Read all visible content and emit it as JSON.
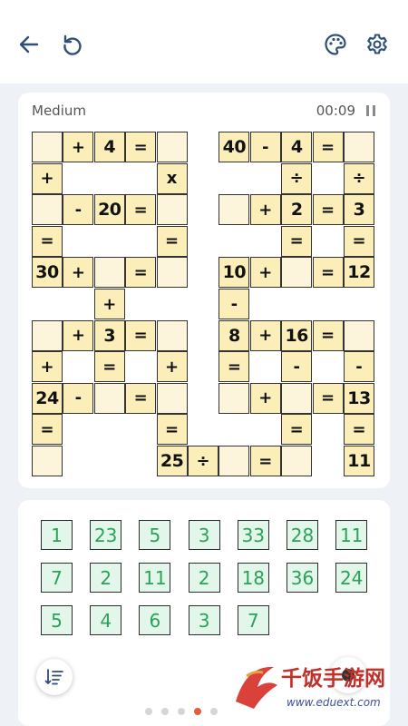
{
  "header": {
    "back_icon": "arrow-left-icon",
    "restart_icon": "restart-icon",
    "theme_icon": "palette-icon",
    "settings_icon": "gear-icon"
  },
  "puzzle": {
    "difficulty": "Medium",
    "timer": "00:09",
    "cells": [
      {
        "c": 0,
        "r": 0,
        "t": "blank",
        "v": ""
      },
      {
        "c": 1,
        "r": 0,
        "t": "op",
        "v": "+"
      },
      {
        "c": 2,
        "r": 0,
        "t": "num",
        "v": "4"
      },
      {
        "c": 3,
        "r": 0,
        "t": "op",
        "v": "="
      },
      {
        "c": 4,
        "r": 0,
        "t": "blank",
        "v": ""
      },
      {
        "c": 6,
        "r": 0,
        "t": "num",
        "v": "40"
      },
      {
        "c": 7,
        "r": 0,
        "t": "op",
        "v": "-"
      },
      {
        "c": 8,
        "r": 0,
        "t": "num",
        "v": "4"
      },
      {
        "c": 9,
        "r": 0,
        "t": "op",
        "v": "="
      },
      {
        "c": 10,
        "r": 0,
        "t": "blank",
        "v": ""
      },
      {
        "c": 0,
        "r": 1,
        "t": "op",
        "v": "+"
      },
      {
        "c": 4,
        "r": 1,
        "t": "op",
        "v": "x"
      },
      {
        "c": 8,
        "r": 1,
        "t": "op",
        "v": "÷"
      },
      {
        "c": 10,
        "r": 1,
        "t": "op",
        "v": "÷"
      },
      {
        "c": 0,
        "r": 2,
        "t": "blank",
        "v": ""
      },
      {
        "c": 1,
        "r": 2,
        "t": "op",
        "v": "-"
      },
      {
        "c": 2,
        "r": 2,
        "t": "num",
        "v": "20"
      },
      {
        "c": 3,
        "r": 2,
        "t": "op",
        "v": "="
      },
      {
        "c": 4,
        "r": 2,
        "t": "blank",
        "v": ""
      },
      {
        "c": 6,
        "r": 2,
        "t": "blank",
        "v": ""
      },
      {
        "c": 7,
        "r": 2,
        "t": "op",
        "v": "+"
      },
      {
        "c": 8,
        "r": 2,
        "t": "num",
        "v": "2"
      },
      {
        "c": 9,
        "r": 2,
        "t": "op",
        "v": "="
      },
      {
        "c": 10,
        "r": 2,
        "t": "num",
        "v": "3"
      },
      {
        "c": 0,
        "r": 3,
        "t": "op",
        "v": "="
      },
      {
        "c": 4,
        "r": 3,
        "t": "op",
        "v": "="
      },
      {
        "c": 8,
        "r": 3,
        "t": "op",
        "v": "="
      },
      {
        "c": 10,
        "r": 3,
        "t": "op",
        "v": "="
      },
      {
        "c": 0,
        "r": 4,
        "t": "num",
        "v": "30"
      },
      {
        "c": 1,
        "r": 4,
        "t": "op",
        "v": "+"
      },
      {
        "c": 2,
        "r": 4,
        "t": "blank",
        "v": ""
      },
      {
        "c": 3,
        "r": 4,
        "t": "op",
        "v": "="
      },
      {
        "c": 4,
        "r": 4,
        "t": "blank",
        "v": ""
      },
      {
        "c": 6,
        "r": 4,
        "t": "num",
        "v": "10"
      },
      {
        "c": 7,
        "r": 4,
        "t": "op",
        "v": "+"
      },
      {
        "c": 8,
        "r": 4,
        "t": "blank",
        "v": ""
      },
      {
        "c": 9,
        "r": 4,
        "t": "op",
        "v": "="
      },
      {
        "c": 10,
        "r": 4,
        "t": "num",
        "v": "12"
      },
      {
        "c": 2,
        "r": 5,
        "t": "op",
        "v": "+"
      },
      {
        "c": 6,
        "r": 5,
        "t": "op",
        "v": "-"
      },
      {
        "c": 0,
        "r": 6,
        "t": "blank",
        "v": ""
      },
      {
        "c": 1,
        "r": 6,
        "t": "op",
        "v": "+"
      },
      {
        "c": 2,
        "r": 6,
        "t": "num",
        "v": "3"
      },
      {
        "c": 3,
        "r": 6,
        "t": "op",
        "v": "="
      },
      {
        "c": 4,
        "r": 6,
        "t": "blank",
        "v": ""
      },
      {
        "c": 6,
        "r": 6,
        "t": "num",
        "v": "8"
      },
      {
        "c": 7,
        "r": 6,
        "t": "op",
        "v": "+"
      },
      {
        "c": 8,
        "r": 6,
        "t": "num",
        "v": "16"
      },
      {
        "c": 9,
        "r": 6,
        "t": "op",
        "v": "="
      },
      {
        "c": 10,
        "r": 6,
        "t": "blank",
        "v": ""
      },
      {
        "c": 0,
        "r": 7,
        "t": "op",
        "v": "+"
      },
      {
        "c": 2,
        "r": 7,
        "t": "op",
        "v": "="
      },
      {
        "c": 4,
        "r": 7,
        "t": "op",
        "v": "+"
      },
      {
        "c": 6,
        "r": 7,
        "t": "op",
        "v": "="
      },
      {
        "c": 8,
        "r": 7,
        "t": "op",
        "v": "-"
      },
      {
        "c": 10,
        "r": 7,
        "t": "op",
        "v": "-"
      },
      {
        "c": 0,
        "r": 8,
        "t": "num",
        "v": "24"
      },
      {
        "c": 1,
        "r": 8,
        "t": "op",
        "v": "-"
      },
      {
        "c": 2,
        "r": 8,
        "t": "blank",
        "v": ""
      },
      {
        "c": 3,
        "r": 8,
        "t": "op",
        "v": "="
      },
      {
        "c": 4,
        "r": 8,
        "t": "blank",
        "v": ""
      },
      {
        "c": 6,
        "r": 8,
        "t": "blank",
        "v": ""
      },
      {
        "c": 7,
        "r": 8,
        "t": "op",
        "v": "+"
      },
      {
        "c": 8,
        "r": 8,
        "t": "blank",
        "v": ""
      },
      {
        "c": 9,
        "r": 8,
        "t": "op",
        "v": "="
      },
      {
        "c": 10,
        "r": 8,
        "t": "num",
        "v": "13"
      },
      {
        "c": 0,
        "r": 9,
        "t": "op",
        "v": "="
      },
      {
        "c": 4,
        "r": 9,
        "t": "op",
        "v": "="
      },
      {
        "c": 8,
        "r": 9,
        "t": "op",
        "v": "="
      },
      {
        "c": 10,
        "r": 9,
        "t": "op",
        "v": "="
      },
      {
        "c": 0,
        "r": 10,
        "t": "blank",
        "v": ""
      },
      {
        "c": 4,
        "r": 10,
        "t": "num",
        "v": "25"
      },
      {
        "c": 5,
        "r": 10,
        "t": "op",
        "v": "÷"
      },
      {
        "c": 6,
        "r": 10,
        "t": "blank",
        "v": ""
      },
      {
        "c": 7,
        "r": 10,
        "t": "op",
        "v": "="
      },
      {
        "c": 8,
        "r": 10,
        "t": "blank",
        "v": ""
      },
      {
        "c": 10,
        "r": 10,
        "t": "num",
        "v": "11"
      }
    ]
  },
  "tiles": [
    "1",
    "23",
    "5",
    "3",
    "33",
    "28",
    "11",
    "7",
    "2",
    "11",
    "2",
    "18",
    "36",
    "24",
    "5",
    "4",
    "6",
    "3",
    "7"
  ],
  "controls": {
    "sort_icon": "sort-descending-icon",
    "hint_icon": "hint-icon"
  },
  "pager": {
    "count": 5,
    "active": 3
  },
  "watermark": {
    "brand": "千饭手游网",
    "site": "www.eduext.com"
  },
  "colors": {
    "cell_fill": "#fbeeb8",
    "tile_fill": "#e3f6ea",
    "tile_text": "#2ba25a",
    "pager_active": "#e85a3a"
  }
}
